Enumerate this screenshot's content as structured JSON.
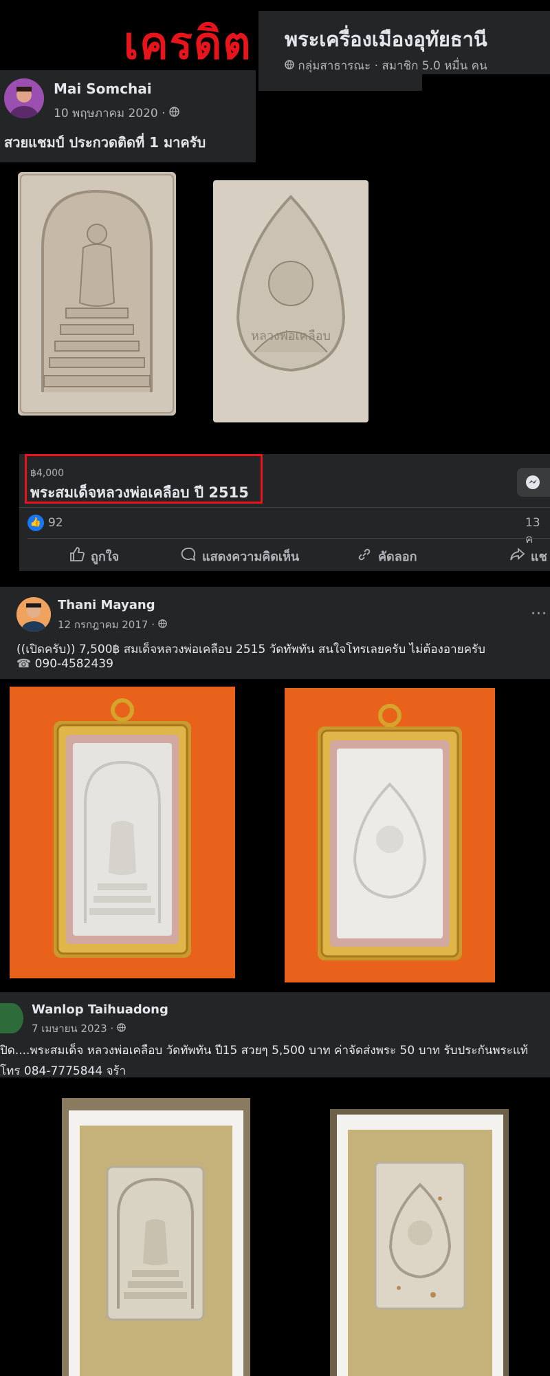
{
  "header": {
    "credit_label": "เครดิต",
    "group_title": "พระเครื่องเมืองอุทัยธานี",
    "group_meta": "กลุ่มสาธารณะ · สมาชิก 5.0 หมื่น คน"
  },
  "post1": {
    "author": "Mai Somchai",
    "date": "10 พฤษภาคม 2020 ·",
    "text": "สวยแชมป์ ประกวดติดที่ 1 มาครับ",
    "price": "฿4,000",
    "item_title": "พระสมเด็จหลวงพ่อเคลือบ ปี 2515",
    "likes": "92",
    "date_cut": "13 ค",
    "actions": {
      "like": "ถูกใจ",
      "comment": "แสดงความคิดเห็น",
      "copy": "คัดลอก",
      "share": "แช"
    }
  },
  "post2": {
    "author": "Thani Mayang",
    "date": "12 กรกฎาคม 2017 ·",
    "text": "((เปิดครับ)) 7,500฿ สมเด็จหลวงพ่อเคลือบ 2515 วัดทัพทัน สนใจโทรเลยครับ ไม่ต้องอายครับ",
    "phone": "090-4582439",
    "more": "···"
  },
  "post3": {
    "author": "Wanlop Taihuadong",
    "date": "7 เมษายน 2023 ·",
    "text": "ปิด....พระสมเด็จ หลวงพ่อเคลือบ วัดทัพทัน ปี15  สวยๆ  5,500  บาท ค่าจัดส่งพระ 50 บาท รับประกันพระแท้",
    "phone": "โทร 084-7775844 จร้า"
  },
  "colors": {
    "panel": "#242526",
    "text": "#e4e6eb",
    "secondary": "#b0b3b8",
    "credit_red": "#e8141b",
    "fb_blue": "#1877f2",
    "orange_bg": "#e8621c",
    "gold_frame": "#d4a52a"
  },
  "icons": [
    "globe-icon",
    "like-icon",
    "comment-icon",
    "copy-icon",
    "share-icon",
    "messenger-icon",
    "more-icon"
  ]
}
